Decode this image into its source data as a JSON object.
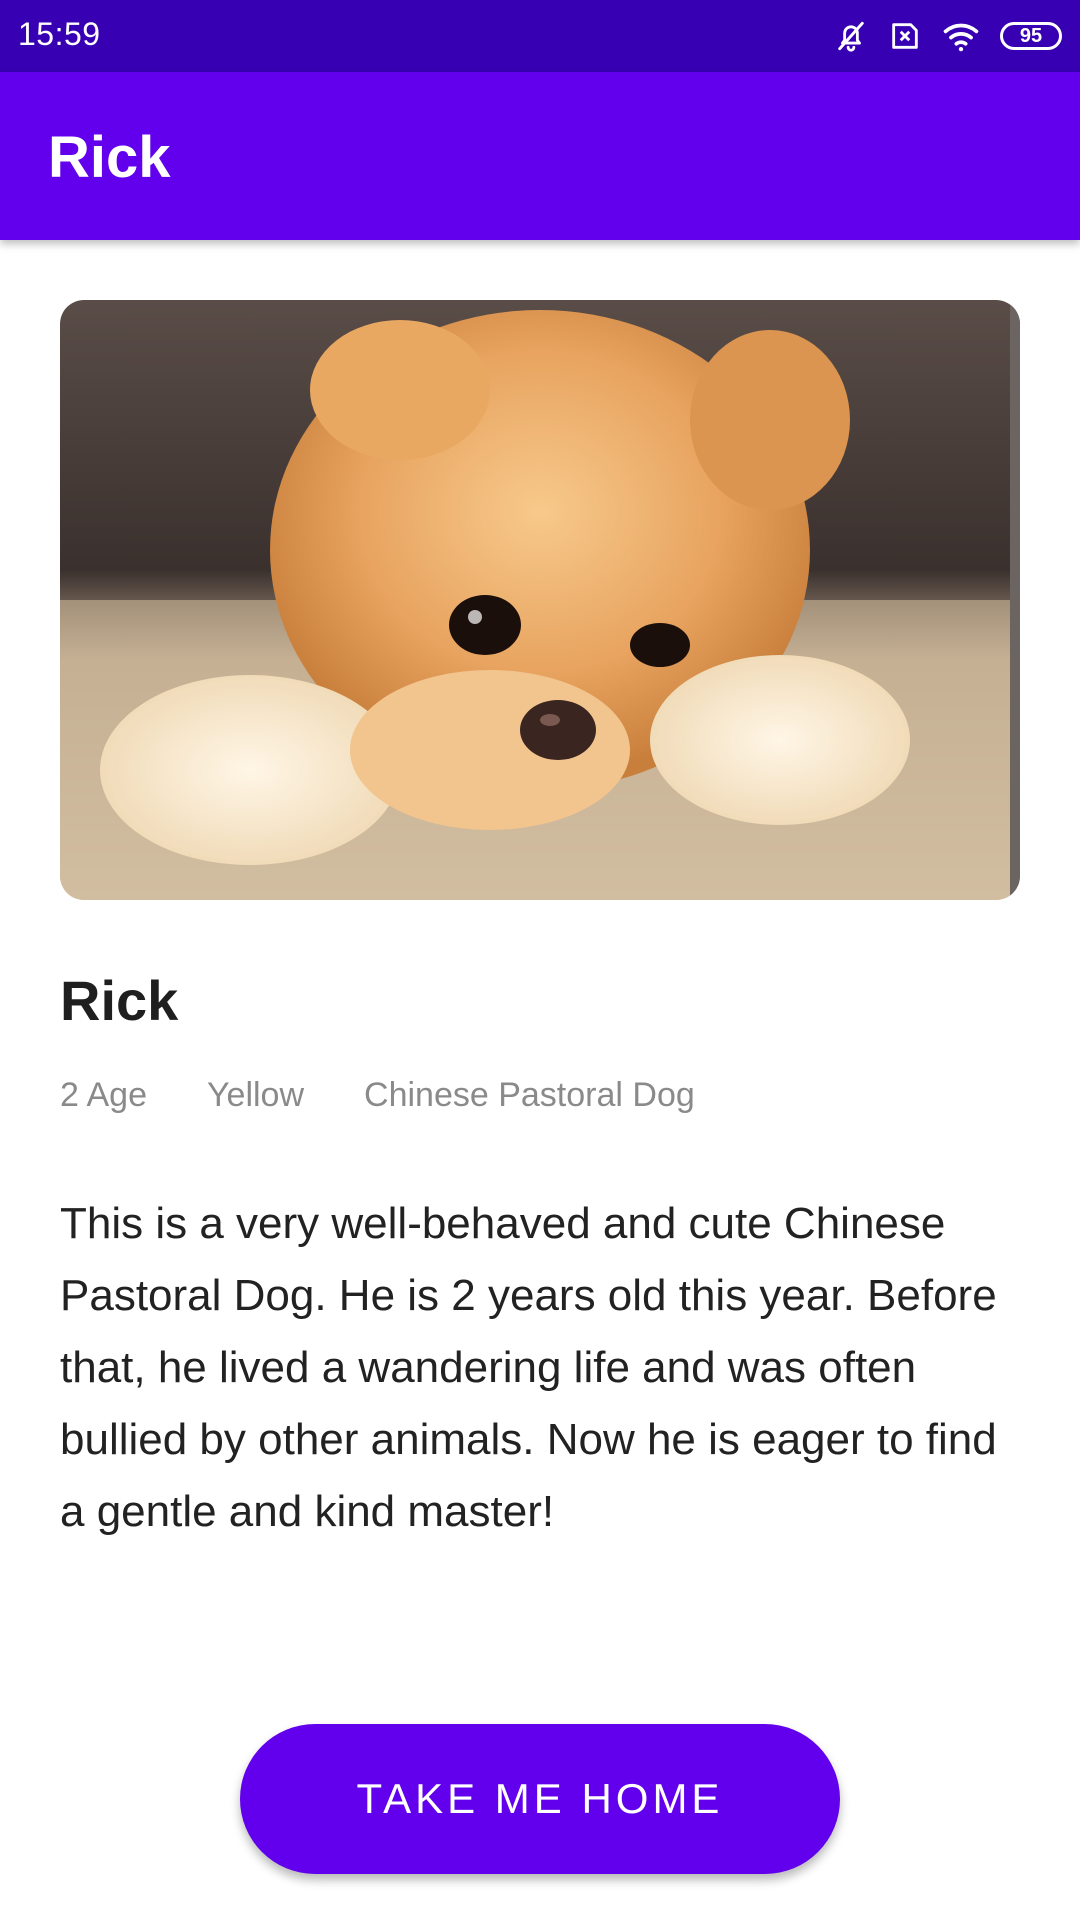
{
  "status_bar": {
    "time": "15:59",
    "battery": "95",
    "icons": [
      "bell-off-icon",
      "sim-x-icon",
      "wifi-icon",
      "battery-icon"
    ]
  },
  "app_bar": {
    "title": "Rick"
  },
  "pet": {
    "photo_icon": "dog-photo",
    "name": "Rick",
    "age": "2 Age",
    "color": "Yellow",
    "breed": "Chinese Pastoral Dog",
    "description": "This is a very well-behaved and cute Chinese Pastoral Dog. He is 2 years old this year. Before that, he lived a wandering life and was often bullied by other animals. Now he is eager to find a gentle and kind master!"
  },
  "actions": {
    "adopt_label": "TAKE ME HOME"
  },
  "colors": {
    "status_bar": "#3700b3",
    "primary": "#6200ee",
    "text_primary": "#222222",
    "text_secondary": "#8a8a8a"
  }
}
